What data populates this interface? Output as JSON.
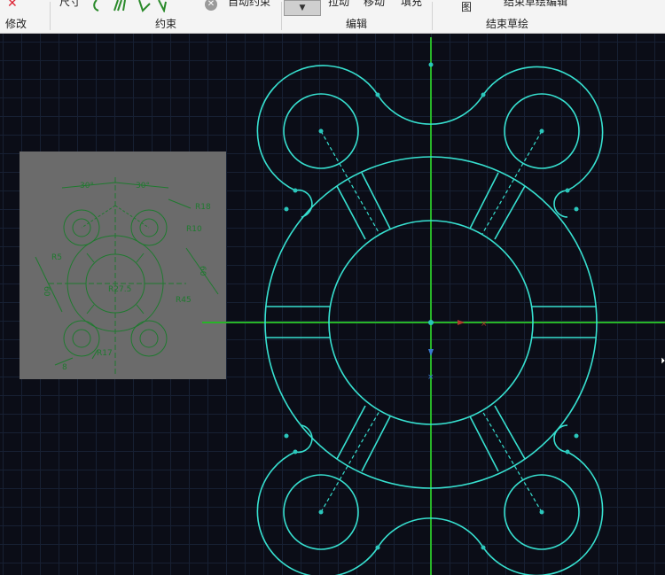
{
  "ribbon": {
    "modify_label": "修改",
    "dimension_label": "尺寸",
    "constraint_group_label": "约束",
    "auto_constraint_label": "自动约束",
    "drag_label": "拉动",
    "move_label": "移动",
    "fill_label": "填充",
    "edit_group_label": "编辑",
    "image_label": "图",
    "finish_sketch_edit_label": "结束草绘编辑",
    "finish_sketch_group_label": "结束草绘"
  },
  "reference_drawing": {
    "dims": {
      "angle_left": "30°",
      "angle_right": "30°",
      "r18": "R18",
      "r10": "R10",
      "r5": "R5",
      "dim_60_left": "60",
      "dim_60_right": "60",
      "r27_5": "R27.5",
      "r45": "R45",
      "r17": "R17",
      "dim_8": "8"
    }
  },
  "colors": {
    "sketch_line": "#37e0d0",
    "axis_line": "#28b428",
    "point": "#2bc6bb",
    "reference_bg": "#6b6b6b",
    "reference_line": "#1f7a2f"
  }
}
